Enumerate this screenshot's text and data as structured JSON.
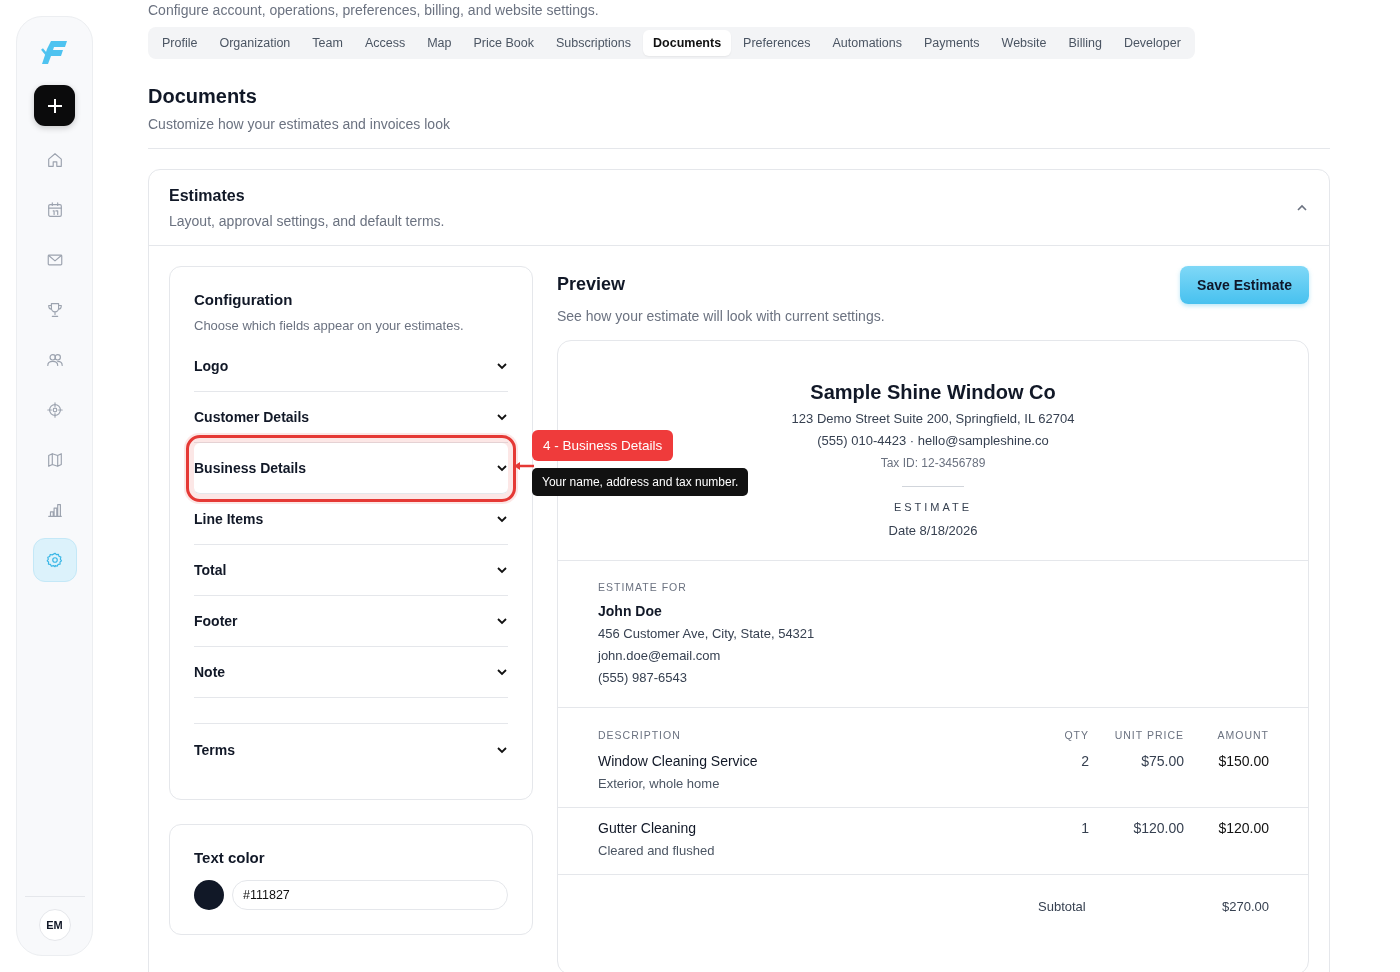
{
  "header": {
    "subtitle": "Configure account, operations, preferences, billing, and website settings."
  },
  "tabs": [
    {
      "label": "Profile",
      "selected": false
    },
    {
      "label": "Organization",
      "selected": false
    },
    {
      "label": "Team",
      "selected": false
    },
    {
      "label": "Access",
      "selected": false
    },
    {
      "label": "Map",
      "selected": false
    },
    {
      "label": "Price Book",
      "selected": false
    },
    {
      "label": "Subscriptions",
      "selected": false
    },
    {
      "label": "Documents",
      "selected": true
    },
    {
      "label": "Preferences",
      "selected": false
    },
    {
      "label": "Automations",
      "selected": false
    },
    {
      "label": "Payments",
      "selected": false
    },
    {
      "label": "Website",
      "selected": false
    },
    {
      "label": "Billing",
      "selected": false
    },
    {
      "label": "Developer",
      "selected": false
    }
  ],
  "sidebar": {
    "items": [
      {
        "kind": "home",
        "selected": false
      },
      {
        "kind": "calendar",
        "selected": false
      },
      {
        "kind": "mail",
        "selected": false
      },
      {
        "kind": "trophy",
        "selected": false
      },
      {
        "kind": "users",
        "selected": false
      },
      {
        "kind": "crosshair",
        "selected": false
      },
      {
        "kind": "map",
        "selected": false
      },
      {
        "kind": "chart",
        "selected": false
      },
      {
        "kind": "settings",
        "selected": true
      }
    ],
    "avatar": "EM"
  },
  "page": {
    "title": "Documents",
    "subtitle": "Customize how your estimates and invoices look"
  },
  "section": {
    "title": "Estimates",
    "subtitle": "Layout, approval settings, and default terms.",
    "expanded": true
  },
  "configuration": {
    "title": "Configuration",
    "subtitle": "Choose which fields appear on your estimates.",
    "items": [
      {
        "label": "Logo",
        "highlighted": false
      },
      {
        "label": "Customer Details",
        "highlighted": false
      },
      {
        "label": "Business Details",
        "highlighted": true
      },
      {
        "label": "Line Items",
        "highlighted": false
      },
      {
        "label": "Total",
        "highlighted": false
      },
      {
        "label": "Footer",
        "highlighted": false
      },
      {
        "label": "Note",
        "highlighted": false
      },
      {
        "label": "Terms",
        "highlighted": false
      }
    ]
  },
  "callout": {
    "label": "4 - Business Details",
    "tooltip": "Your name, address and tax number."
  },
  "text_color": {
    "title": "Text color",
    "value": "#111827",
    "color": "#111827"
  },
  "preview": {
    "title": "Preview",
    "subtitle": "See how your estimate will look with current settings.",
    "save_button": "Save Estimate"
  },
  "document": {
    "company": "Sample Shine Window Co",
    "address": "123 Demo Street Suite 200, Springfield, IL 62704",
    "contact": "(555) 010-4423 · hello@sampleshine.co",
    "tax_id": "Tax ID: 12-3456789",
    "doc_type": "ESTIMATE",
    "date": "Date 8/18/2026",
    "bill_to": {
      "label": "ESTIMATE FOR",
      "name": "John Doe",
      "lines": [
        "456 Customer Ave, City, State, 54321",
        "john.doe@email.com",
        "(555) 987-6543"
      ]
    },
    "columns": [
      "DESCRIPTION",
      "QTY",
      "UNIT PRICE",
      "AMOUNT"
    ],
    "rows": [
      {
        "description": "Window Cleaning Service",
        "detail": "Exterior, whole home",
        "qty": "2",
        "unit_price": "$75.00",
        "amount": "$150.00"
      },
      {
        "description": "Gutter Cleaning",
        "detail": "Cleared and flushed",
        "qty": "1",
        "unit_price": "$120.00",
        "amount": "$120.00"
      }
    ],
    "totals": [
      {
        "label": "Subtotal",
        "value": "$270.00"
      }
    ]
  }
}
